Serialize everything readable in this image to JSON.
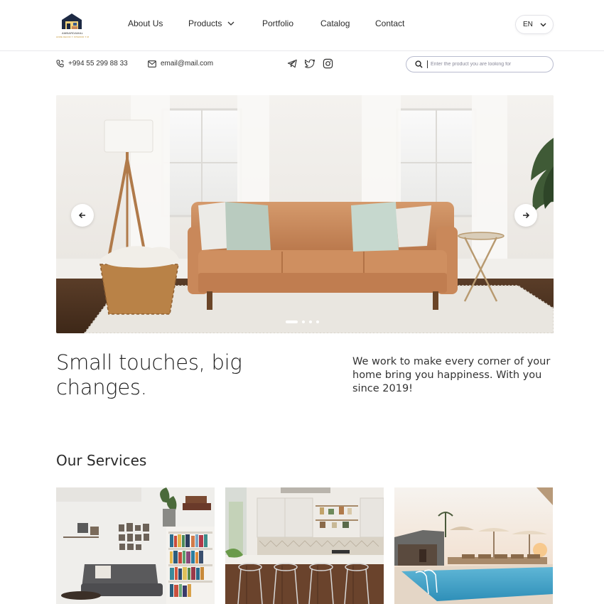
{
  "header": {
    "logo_text": "AMBARDAMAL",
    "logo_subtext": "HOME DECOR ✦ INTERIOR ✦ RETAIL",
    "nav": [
      {
        "label": "About Us"
      },
      {
        "label": "Products"
      },
      {
        "label": "Portfolio"
      },
      {
        "label": "Catalog"
      },
      {
        "label": "Contact"
      }
    ],
    "language": "EN"
  },
  "contact": {
    "phone": "+994 55 299 88 33",
    "email": "email@mail.com",
    "socials": [
      "telegram-icon",
      "twitter-icon",
      "instagram-icon"
    ]
  },
  "search": {
    "placeholder": "Enter the product you are looking for"
  },
  "hero": {
    "slide_count": 4,
    "active_slide": 1
  },
  "intro": {
    "headline": "Small touches, big changes.",
    "description": "We work to make every corner of your home bring you happiness. With you since 2019!"
  },
  "services": {
    "title": "Our Services"
  },
  "colors": {
    "accent": "#c8875a",
    "text": "#222222",
    "border": "#e8e8ec"
  }
}
